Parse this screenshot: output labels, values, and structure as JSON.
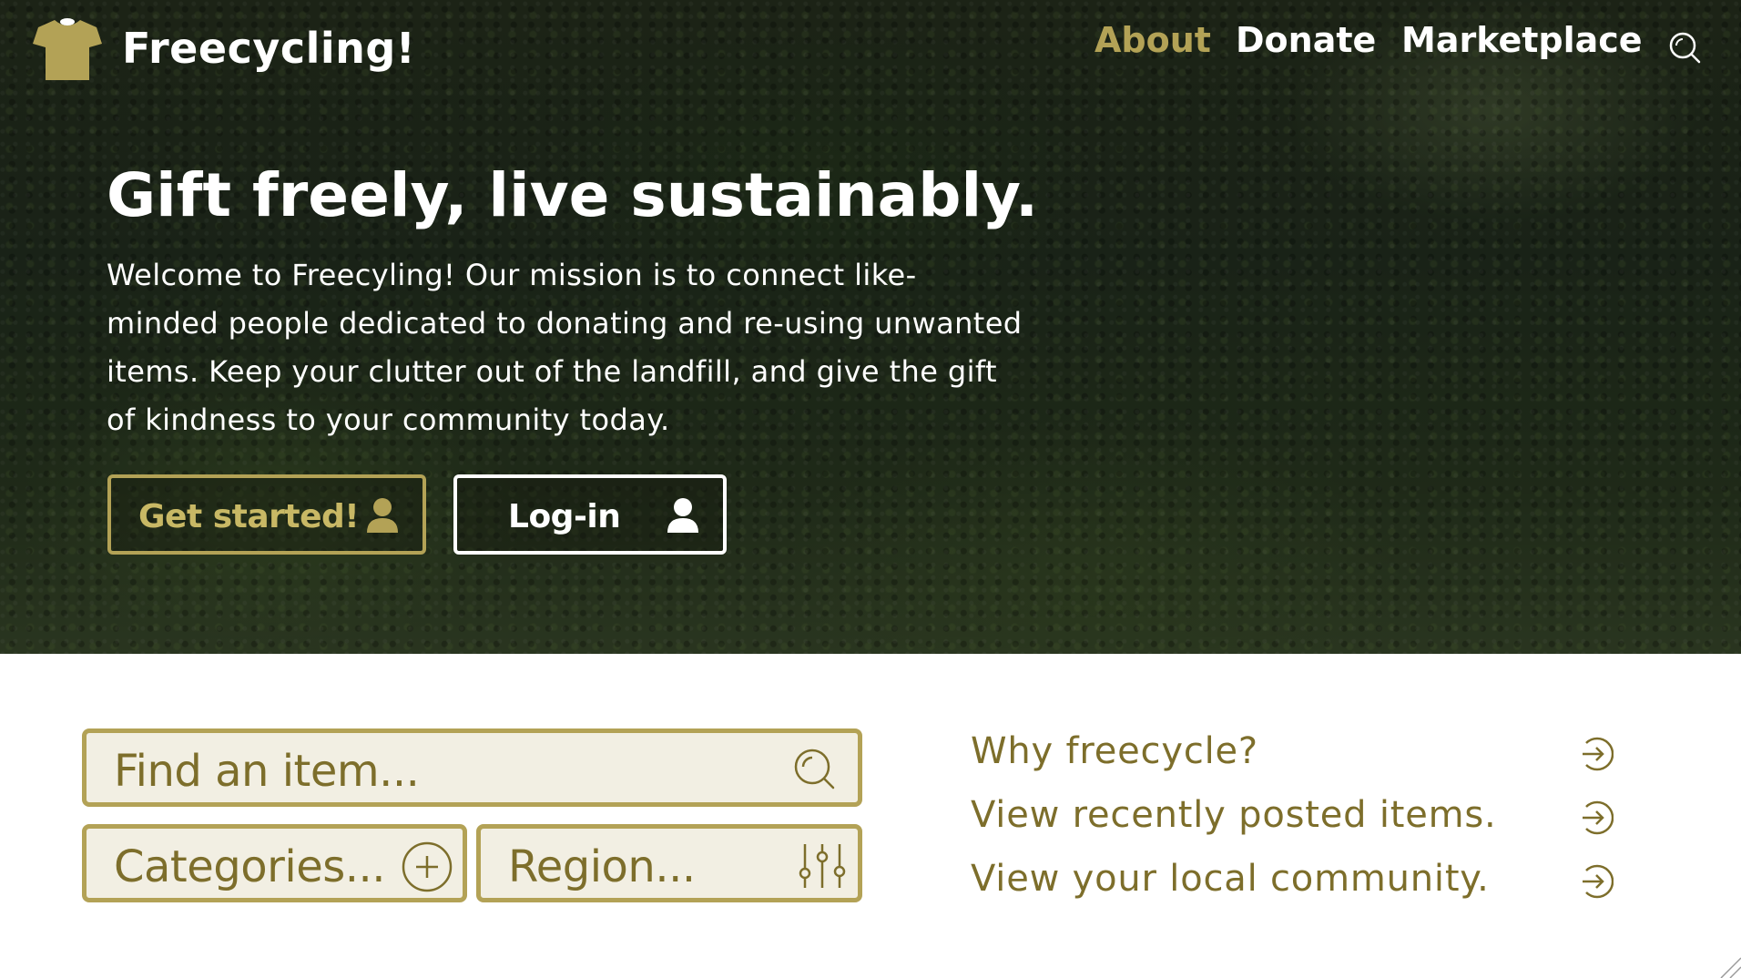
{
  "header": {
    "brand": "Freecycling!",
    "logo_icon": "tshirt-icon",
    "nav": {
      "about": "About",
      "donate": "Donate",
      "marketplace": "Marketplace",
      "search_icon": "search-icon"
    }
  },
  "hero": {
    "headline": "Gift freely, live sustainably.",
    "intro": "Welcome to Freecyling! Our mission is to connect like-minded people dedicated to donating and re-using unwanted items. Keep your clutter out of the landfill, and give the gift of kindness to your community today.",
    "get_started_label": "Get started!",
    "login_label": "Log-in",
    "button_icon": "user-icon"
  },
  "search": {
    "find_placeholder": "Find an item...",
    "categories_label": "Categories...",
    "region_label": "Region..."
  },
  "links": [
    {
      "label": "Why freecycle?"
    },
    {
      "label": "View recently posted items."
    },
    {
      "label": "View your local community."
    }
  ],
  "colors": {
    "accent": "#b3a256",
    "accent_text": "#7d6e2b",
    "field_bg": "#f2efe3",
    "white": "#ffffff"
  }
}
